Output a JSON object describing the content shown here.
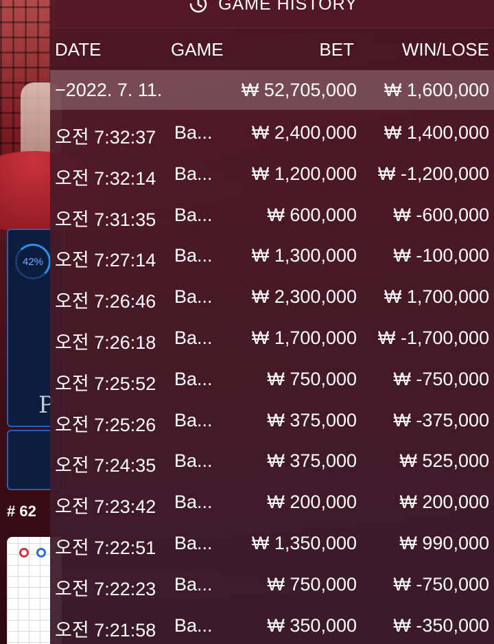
{
  "background": {
    "gauge_text": "42%",
    "panel_letter": "P",
    "round_label": "# 62"
  },
  "history": {
    "title": "GAME HISTORY",
    "title_icon": "history-clock-icon",
    "columns": {
      "date": "DATE",
      "game": "GAME",
      "bet": "BET",
      "win_lose": "WIN/LOSE"
    },
    "summary": {
      "date": "−2022. 7. 11.",
      "bet": "₩ 52,705,000",
      "win_lose": "₩ 1,600,000"
    },
    "rows": [
      {
        "time": "오전 7:32:37",
        "game": "Ba...",
        "bet": "₩ 2,400,000",
        "win_lose": "₩ 1,400,000"
      },
      {
        "time": "오전 7:32:14",
        "game": "Ba...",
        "bet": "₩ 1,200,000",
        "win_lose": "₩ -1,200,000"
      },
      {
        "time": "오전 7:31:35",
        "game": "Ba...",
        "bet": "₩ 600,000",
        "win_lose": "₩ -600,000"
      },
      {
        "time": "오전 7:27:14",
        "game": "Ba...",
        "bet": "₩ 1,300,000",
        "win_lose": "₩ -100,000"
      },
      {
        "time": "오전 7:26:46",
        "game": "Ba...",
        "bet": "₩ 2,300,000",
        "win_lose": "₩ 1,700,000"
      },
      {
        "time": "오전 7:26:18",
        "game": "Ba...",
        "bet": "₩ 1,700,000",
        "win_lose": "₩ -1,700,000"
      },
      {
        "time": "오전 7:25:52",
        "game": "Ba...",
        "bet": "₩ 750,000",
        "win_lose": "₩ -750,000"
      },
      {
        "time": "오전 7:25:26",
        "game": "Ba...",
        "bet": "₩ 375,000",
        "win_lose": "₩ -375,000"
      },
      {
        "time": "오전 7:24:35",
        "game": "Ba...",
        "bet": "₩ 375,000",
        "win_lose": "₩ 525,000"
      },
      {
        "time": "오전 7:23:42",
        "game": "Ba...",
        "bet": "₩ 200,000",
        "win_lose": "₩ 200,000"
      },
      {
        "time": "오전 7:22:51",
        "game": "Ba...",
        "bet": "₩ 1,350,000",
        "win_lose": "₩ 990,000"
      },
      {
        "time": "오전 7:22:23",
        "game": "Ba...",
        "bet": "₩ 750,000",
        "win_lose": "₩ -750,000"
      },
      {
        "time": "오전 7:21:58",
        "game": "Ba...",
        "bet": "₩ 350,000",
        "win_lose": "₩ -350,000"
      }
    ]
  },
  "colors": {
    "player_blue": "#2e5cae",
    "banker_red": "#d0313c",
    "overlay": "#541826"
  }
}
